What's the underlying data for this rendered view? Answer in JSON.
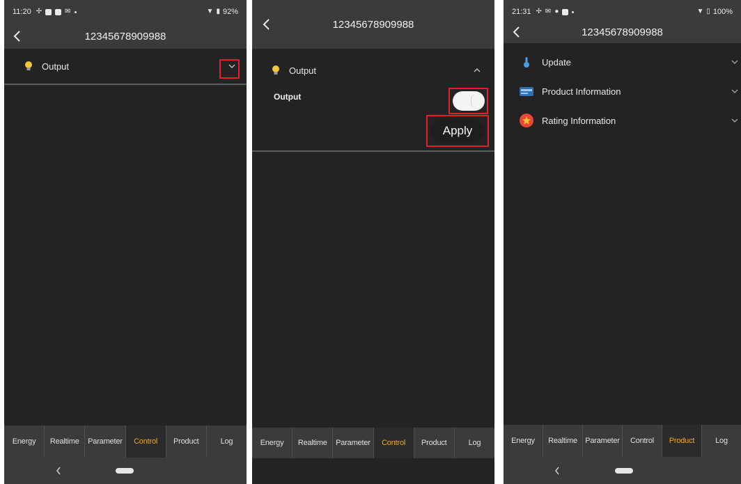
{
  "screens": [
    {
      "status": {
        "time": "11:20",
        "battery": "92%"
      },
      "header": {
        "title": "12345678909988"
      },
      "rows": [
        {
          "label": "Output",
          "icon": "lightbulb-icon",
          "expanded": false
        }
      ],
      "tabs": [
        "Energy",
        "Realtime",
        "Parameter",
        "Control",
        "Product",
        "Log"
      ],
      "active_tab": "Control"
    },
    {
      "header": {
        "title": "12345678909988"
      },
      "rows": [
        {
          "label": "Output",
          "icon": "lightbulb-icon",
          "expanded": true
        }
      ],
      "control": {
        "output_label": "Output",
        "output_on": true,
        "apply_label": "Apply"
      },
      "tabs": [
        "Energy",
        "Realtime",
        "Parameter",
        "Control",
        "Product",
        "Log"
      ],
      "active_tab": "Control"
    },
    {
      "status": {
        "time": "21:31",
        "battery": "100%"
      },
      "header": {
        "title": "12345678909988"
      },
      "rows": [
        {
          "label": "Update",
          "icon": "thermometer-icon"
        },
        {
          "label": "Product Information",
          "icon": "device-info-icon"
        },
        {
          "label": "Rating Information",
          "icon": "star-badge-icon"
        }
      ],
      "tabs": [
        "Energy",
        "Realtime",
        "Parameter",
        "Control",
        "Product",
        "Log"
      ],
      "active_tab": "Product"
    }
  ],
  "colors": {
    "accent": "#f0a818",
    "highlight_box": "#e0202a",
    "background": "#232323",
    "bars": "#3b3b3b"
  }
}
